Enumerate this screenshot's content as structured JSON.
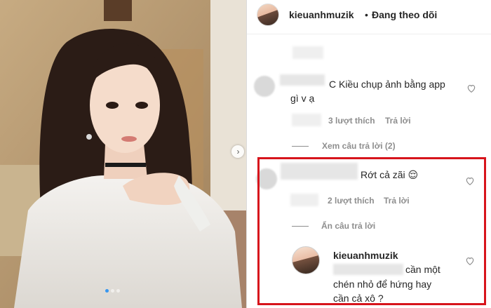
{
  "header": {
    "username": "kieuanhmuzik",
    "separator": "•",
    "follow_status": "Đang theo dõi"
  },
  "comments": [
    {
      "text_line1": "C Kiều chụp ảnh bằng app",
      "text_line2": "gì v ạ",
      "likes": "3 lượt thích",
      "reply_label": "Trả lời",
      "view_replies": "Xem câu trả lời (2)"
    },
    {
      "text": "Rớt cả zãi 😌",
      "likes": "2 lượt thích",
      "reply_label": "Trả lời",
      "hide_replies": "Ẩn câu trả lời"
    }
  ],
  "reply": {
    "username": "kieuanhmuzik",
    "text_line1": "cần một",
    "text_line2": "chén nhỏ để hứng hay",
    "text_line3": "cần cả xô ?"
  },
  "colors": {
    "highlight": "#d7141c",
    "meta_text": "#8e8e8e",
    "link_blue": "#3897f0"
  },
  "icons": {
    "like": "heart-outline-icon",
    "next": "chevron-right-icon"
  }
}
